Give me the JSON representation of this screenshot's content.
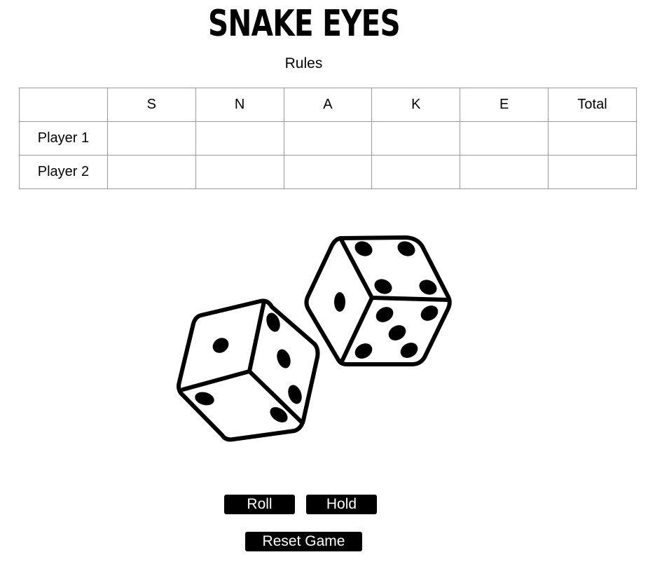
{
  "header": {
    "title": "SNAKE EYES",
    "rules_link": "Rules"
  },
  "scoreboard": {
    "columns": [
      "",
      "S",
      "N",
      "A",
      "K",
      "E",
      "Total"
    ],
    "rows": [
      {
        "player": "Player 1",
        "cells": [
          "",
          "",
          "",
          "",
          "",
          ""
        ]
      },
      {
        "player": "Player 2",
        "cells": [
          "",
          "",
          "",
          "",
          "",
          ""
        ]
      }
    ]
  },
  "dice_image": {
    "icon": "two-dice-icon",
    "description_hidden": true
  },
  "controls": {
    "roll_label": "Roll",
    "hold_label": "Hold",
    "reset_label": "Reset Game"
  }
}
